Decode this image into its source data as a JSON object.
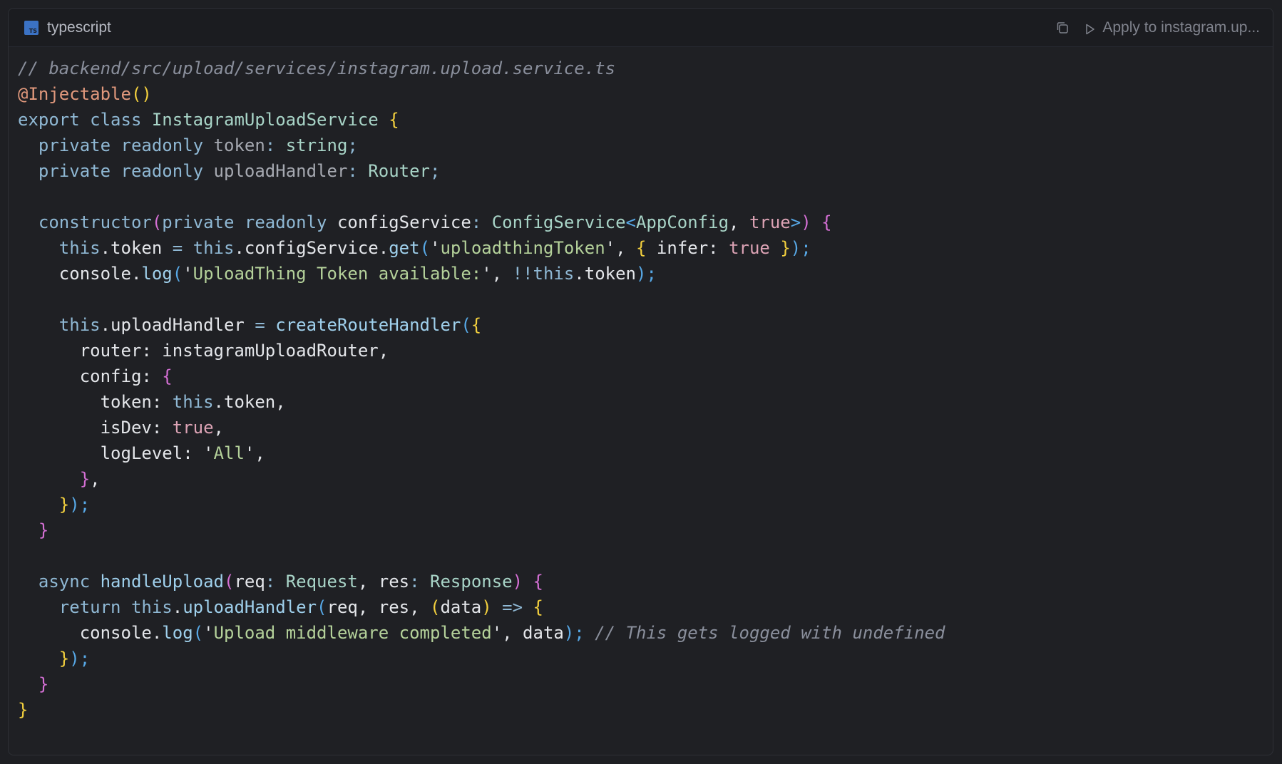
{
  "header": {
    "language": "typescript",
    "language_icon": "typescript-icon",
    "copy_icon": "copy-icon",
    "apply_label": "Apply to instagram.up..."
  },
  "code": {
    "lines": [
      [
        {
          "t": "// backend/src/upload/services/instagram.upload.service.ts",
          "c": "cm"
        }
      ],
      [
        {
          "t": "@Injectable",
          "c": "dec"
        },
        {
          "t": "()",
          "c": "b1"
        }
      ],
      [
        {
          "t": "export class ",
          "c": "kw"
        },
        {
          "t": "InstagramUploadService ",
          "c": "ty"
        },
        {
          "t": "{",
          "c": "b1"
        }
      ],
      [
        {
          "t": "  private readonly ",
          "c": "kw"
        },
        {
          "t": "token",
          "c": "mut"
        },
        {
          "t": ": ",
          "c": "op"
        },
        {
          "t": "string",
          "c": "ty"
        },
        {
          "t": ";",
          "c": "op"
        }
      ],
      [
        {
          "t": "  private readonly ",
          "c": "kw"
        },
        {
          "t": "uploadHandler",
          "c": "mut"
        },
        {
          "t": ": ",
          "c": "op"
        },
        {
          "t": "Router",
          "c": "ty"
        },
        {
          "t": ";",
          "c": "op"
        }
      ],
      [],
      [
        {
          "t": "  constructor",
          "c": "kw"
        },
        {
          "t": "(",
          "c": "b2"
        },
        {
          "t": "private readonly ",
          "c": "kw"
        },
        {
          "t": "configService",
          "c": ""
        },
        {
          "t": ": ",
          "c": "op"
        },
        {
          "t": "ConfigService",
          "c": "ty"
        },
        {
          "t": "<",
          "c": "b3"
        },
        {
          "t": "AppConfig",
          "c": "ty"
        },
        {
          "t": ", ",
          "c": ""
        },
        {
          "t": "true",
          "c": "num"
        },
        {
          "t": ">",
          "c": "b3"
        },
        {
          "t": ") ",
          "c": "b2"
        },
        {
          "t": "{",
          "c": "b2"
        }
      ],
      [
        {
          "t": "    this",
          "c": "kw"
        },
        {
          "t": ".token ",
          "c": ""
        },
        {
          "t": "= ",
          "c": "op"
        },
        {
          "t": "this",
          "c": "kw"
        },
        {
          "t": ".configService.",
          "c": ""
        },
        {
          "t": "get",
          "c": "fn"
        },
        {
          "t": "(",
          "c": "b3"
        },
        {
          "t": "'",
          "c": ""
        },
        {
          "t": "uploadthingToken",
          "c": "str"
        },
        {
          "t": "', ",
          "c": ""
        },
        {
          "t": "{ ",
          "c": "b1"
        },
        {
          "t": "infer: ",
          "c": ""
        },
        {
          "t": "true ",
          "c": "num"
        },
        {
          "t": "}",
          "c": "b1"
        },
        {
          "t": ");",
          "c": "b3"
        }
      ],
      [
        {
          "t": "    console.",
          "c": ""
        },
        {
          "t": "log",
          "c": "fn"
        },
        {
          "t": "(",
          "c": "b3"
        },
        {
          "t": "'",
          "c": ""
        },
        {
          "t": "UploadThing Token available:",
          "c": "str"
        },
        {
          "t": "', ",
          "c": ""
        },
        {
          "t": "!!",
          "c": "op"
        },
        {
          "t": "this",
          "c": "kw"
        },
        {
          "t": ".token",
          "c": ""
        },
        {
          "t": ");",
          "c": "b3"
        }
      ],
      [],
      [
        {
          "t": "    this",
          "c": "kw"
        },
        {
          "t": ".uploadHandler ",
          "c": ""
        },
        {
          "t": "= ",
          "c": "op"
        },
        {
          "t": "createRouteHandler",
          "c": "fn"
        },
        {
          "t": "(",
          "c": "b3"
        },
        {
          "t": "{",
          "c": "b1"
        }
      ],
      [
        {
          "t": "      router: instagramUploadRouter,",
          "c": ""
        }
      ],
      [
        {
          "t": "      config: ",
          "c": ""
        },
        {
          "t": "{",
          "c": "b2"
        }
      ],
      [
        {
          "t": "        token: ",
          "c": ""
        },
        {
          "t": "this",
          "c": "kw"
        },
        {
          "t": ".token,",
          "c": ""
        }
      ],
      [
        {
          "t": "        isDev: ",
          "c": ""
        },
        {
          "t": "true",
          "c": "num"
        },
        {
          "t": ",",
          "c": ""
        }
      ],
      [
        {
          "t": "        logLevel: '",
          "c": ""
        },
        {
          "t": "All",
          "c": "str"
        },
        {
          "t": "',",
          "c": ""
        }
      ],
      [
        {
          "t": "      ",
          "c": ""
        },
        {
          "t": "}",
          "c": "b2"
        },
        {
          "t": ",",
          "c": ""
        }
      ],
      [
        {
          "t": "    ",
          "c": ""
        },
        {
          "t": "}",
          "c": "b1"
        },
        {
          "t": ");",
          "c": "b3"
        }
      ],
      [
        {
          "t": "  ",
          "c": ""
        },
        {
          "t": "}",
          "c": "b2"
        }
      ],
      [],
      [
        {
          "t": "  async ",
          "c": "kw"
        },
        {
          "t": "handleUpload",
          "c": "fn"
        },
        {
          "t": "(",
          "c": "b2"
        },
        {
          "t": "req",
          "c": ""
        },
        {
          "t": ": ",
          "c": "op"
        },
        {
          "t": "Request",
          "c": "ty"
        },
        {
          "t": ", ",
          "c": ""
        },
        {
          "t": "res",
          "c": ""
        },
        {
          "t": ": ",
          "c": "op"
        },
        {
          "t": "Response",
          "c": "ty"
        },
        {
          "t": ") ",
          "c": "b2"
        },
        {
          "t": "{",
          "c": "b2"
        }
      ],
      [
        {
          "t": "    return ",
          "c": "kw"
        },
        {
          "t": "this",
          "c": "kw"
        },
        {
          "t": ".",
          "c": ""
        },
        {
          "t": "uploadHandler",
          "c": "fn"
        },
        {
          "t": "(",
          "c": "b3"
        },
        {
          "t": "req, res, ",
          "c": ""
        },
        {
          "t": "(",
          "c": "b1"
        },
        {
          "t": "data",
          "c": ""
        },
        {
          "t": ") ",
          "c": "b1"
        },
        {
          "t": "=> ",
          "c": "op"
        },
        {
          "t": "{",
          "c": "b1"
        }
      ],
      [
        {
          "t": "      console.",
          "c": ""
        },
        {
          "t": "log",
          "c": "fn"
        },
        {
          "t": "(",
          "c": "b3"
        },
        {
          "t": "'",
          "c": ""
        },
        {
          "t": "Upload middleware completed",
          "c": "str"
        },
        {
          "t": "', data",
          "c": ""
        },
        {
          "t": "); ",
          "c": "b3"
        },
        {
          "t": "// This gets logged with undefined",
          "c": "cm"
        }
      ],
      [
        {
          "t": "    ",
          "c": ""
        },
        {
          "t": "}",
          "c": "b1"
        },
        {
          "t": ");",
          "c": "b3"
        }
      ],
      [
        {
          "t": "  ",
          "c": ""
        },
        {
          "t": "}",
          "c": "b2"
        }
      ],
      [
        {
          "t": "}",
          "c": "b1"
        }
      ]
    ]
  }
}
